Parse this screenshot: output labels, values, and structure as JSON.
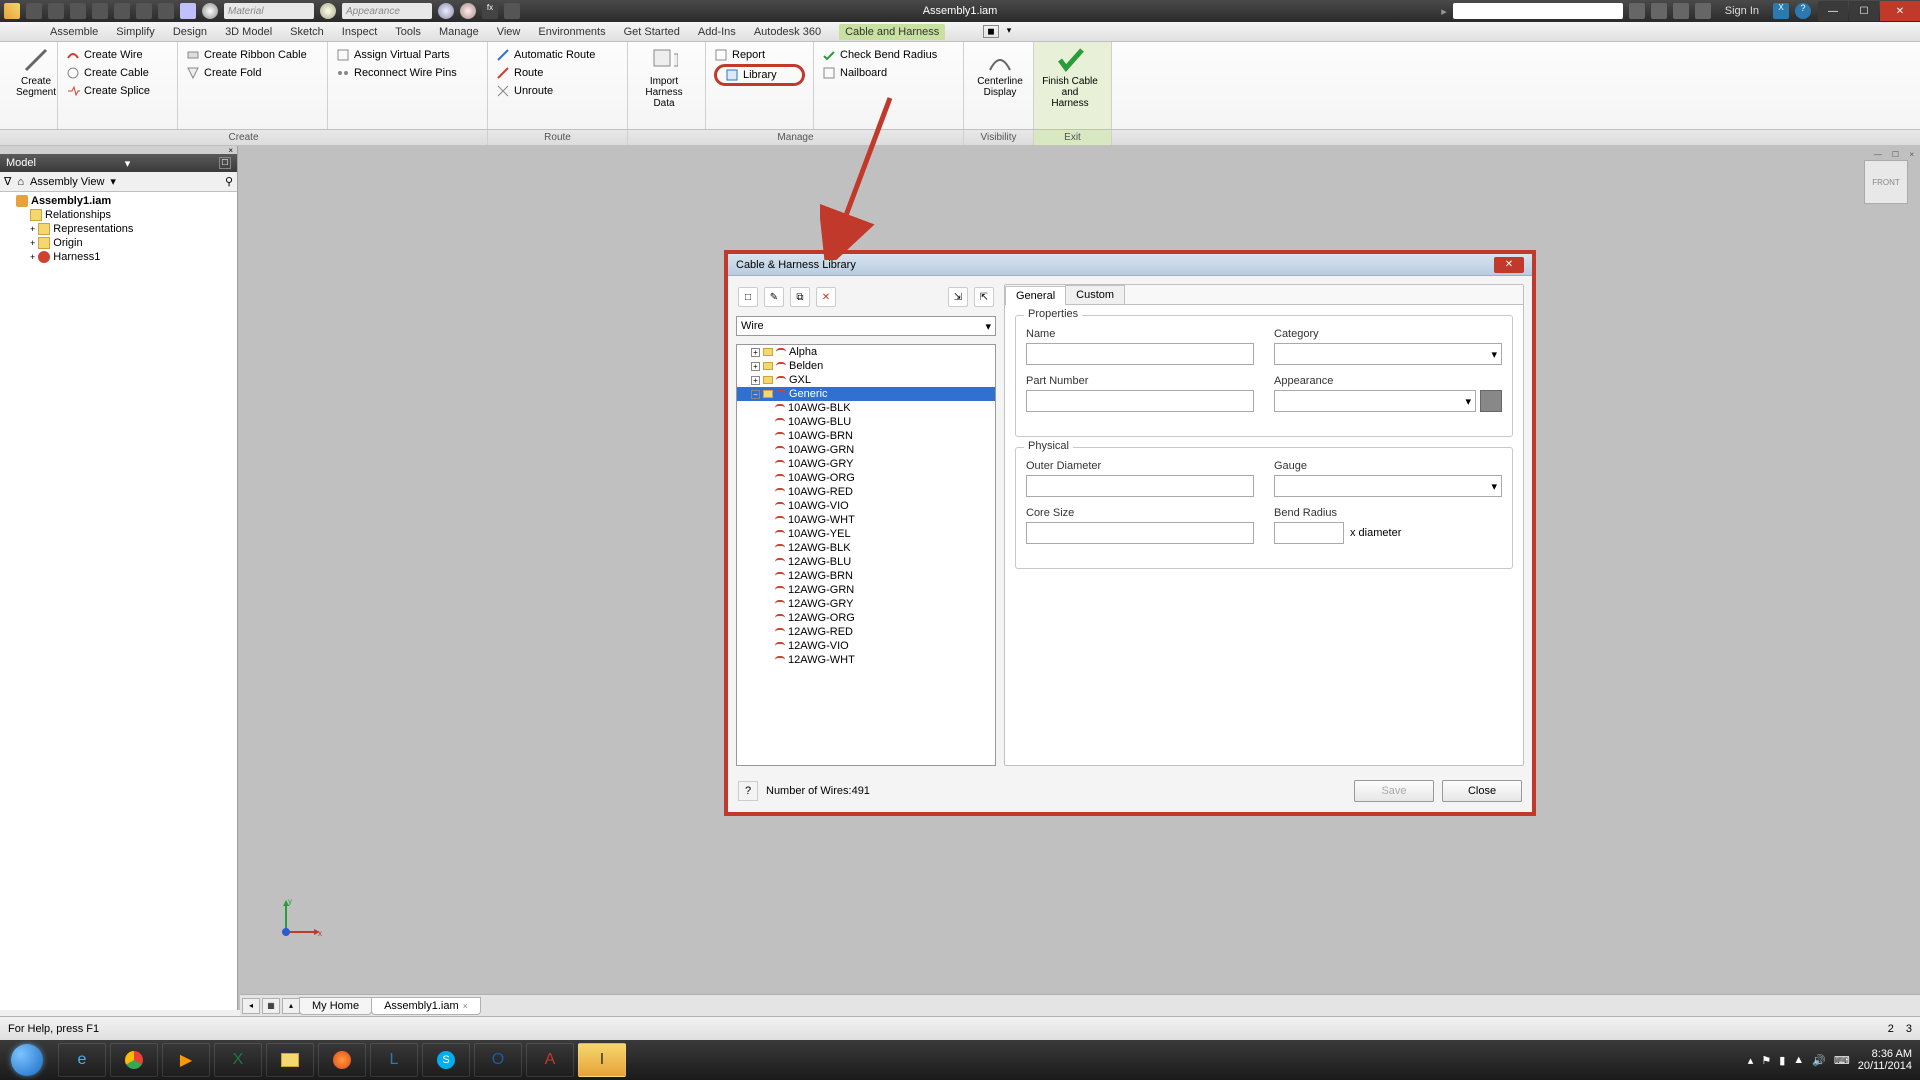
{
  "title": "Assembly1.iam",
  "material_placeholder": "Material",
  "appearance_placeholder": "Appearance",
  "signin": "Sign In",
  "ribbon_tabs": [
    "Assemble",
    "Simplify",
    "Design",
    "3D Model",
    "Sketch",
    "Inspect",
    "Tools",
    "Manage",
    "View",
    "Environments",
    "Get Started",
    "Add-Ins",
    "Autodesk 360",
    "Cable and Harness"
  ],
  "ribbon": {
    "create_segment": "Create\nSegment",
    "create_wire": "Create Wire",
    "create_cable": "Create Cable",
    "create_splice": "Create Splice",
    "create_ribbon": "Create Ribbon Cable",
    "create_fold": "Create Fold",
    "assign_vp": "Assign Virtual Parts",
    "reconnect": "Reconnect Wire Pins",
    "auto_route": "Automatic Route",
    "route": "Route",
    "unroute": "Unroute",
    "import": "Import\nHarness Data",
    "report": "Report",
    "library": "Library",
    "check_bend": "Check Bend Radius",
    "nailboard": "Nailboard",
    "centerline": "Centerline\nDisplay",
    "finish": "Finish Cable\nand Harness",
    "panels": {
      "create": "Create",
      "route": "Route",
      "manage": "Manage",
      "visibility": "Visibility",
      "exit": "Exit"
    }
  },
  "browser": {
    "title": "Model",
    "view": "Assembly View",
    "items": [
      "Assembly1.iam",
      "Relationships",
      "Representations",
      "Origin",
      "Harness1"
    ]
  },
  "viewcube": "FRONT",
  "dialog": {
    "title": "Cable & Harness Library",
    "type": "Wire",
    "tabs": {
      "general": "General",
      "custom": "Custom"
    },
    "sections": {
      "props": "Properties",
      "phys": "Physical"
    },
    "labels": {
      "name": "Name",
      "category": "Category",
      "part": "Part Number",
      "appearance": "Appearance",
      "od": "Outer Diameter",
      "gauge": "Gauge",
      "core": "Core Size",
      "bend": "Bend Radius",
      "xdia": "x diameter"
    },
    "categories": [
      "Alpha",
      "Belden",
      "GXL",
      "Generic"
    ],
    "selected_category": "Generic",
    "wires": [
      "10AWG-BLK",
      "10AWG-BLU",
      "10AWG-BRN",
      "10AWG-GRN",
      "10AWG-GRY",
      "10AWG-ORG",
      "10AWG-RED",
      "10AWG-VIO",
      "10AWG-WHT",
      "10AWG-YEL",
      "12AWG-BLK",
      "12AWG-BLU",
      "12AWG-BRN",
      "12AWG-GRN",
      "12AWG-GRY",
      "12AWG-ORG",
      "12AWG-RED",
      "12AWG-VIO",
      "12AWG-WHT"
    ],
    "count_label": "Number of Wires:491",
    "save": "Save",
    "close": "Close"
  },
  "doc_tabs": {
    "home": "My Home",
    "doc": "Assembly1.iam"
  },
  "status": {
    "help": "For Help, press F1",
    "n2": "2",
    "n3": "3"
  },
  "tray": {
    "time": "8:36 AM",
    "date": "20/11/2014"
  }
}
